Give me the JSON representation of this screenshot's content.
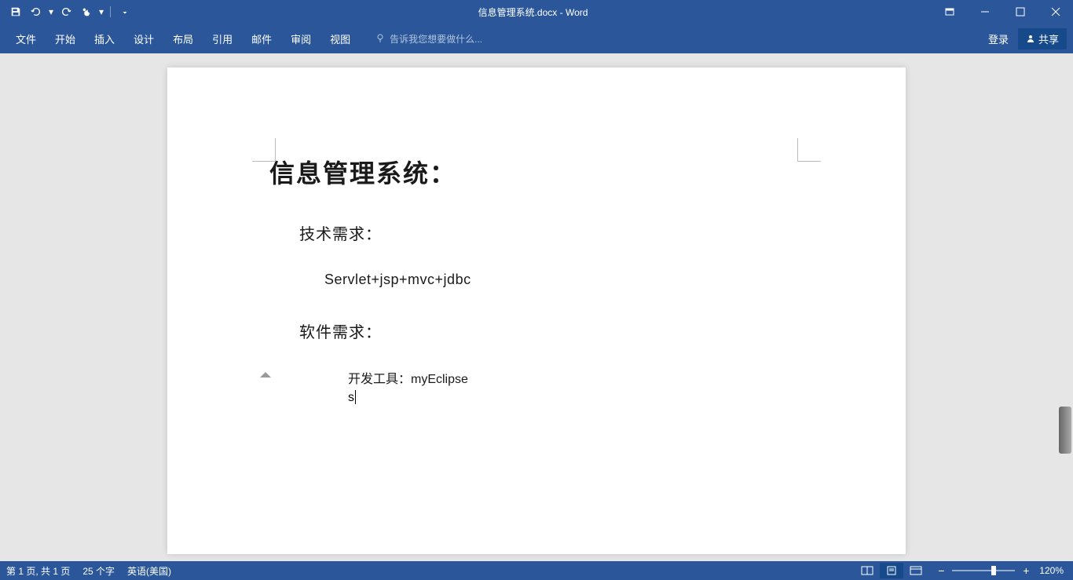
{
  "window": {
    "title_doc": "信息管理系统.docx",
    "title_app": "Word"
  },
  "ribbon": {
    "tabs": [
      "文件",
      "开始",
      "插入",
      "设计",
      "布局",
      "引用",
      "邮件",
      "审阅",
      "视图"
    ],
    "tellme_placeholder": "告诉我您想要做什么...",
    "login": "登录",
    "share": "共享"
  },
  "document": {
    "title": "信息管理系统：",
    "section1_heading": "技术需求：",
    "section1_body": "Servlet+jsp+mvc+jdbc",
    "section2_heading": "软件需求：",
    "section2_body": "开发工具：myEclipse",
    "typing": "s"
  },
  "status": {
    "page": "第 1 页, 共 1 页",
    "words": "25 个字",
    "language": "英语(美国)",
    "zoom": "120%"
  }
}
